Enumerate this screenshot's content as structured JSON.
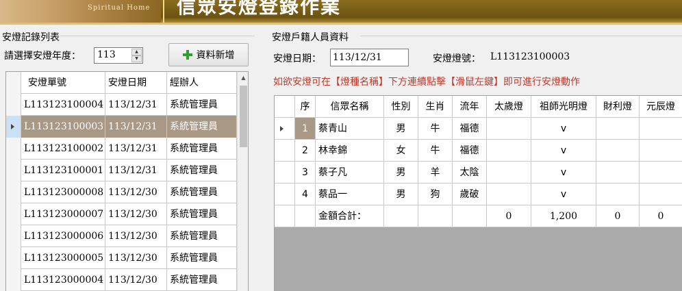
{
  "banner": {
    "subtitle": "Spiritual Home",
    "title": "信眾安燈登錄作業"
  },
  "left_panel": {
    "group_title": "安燈記錄列表",
    "year_label": "請選擇安燈年度：",
    "year_value": "113",
    "add_button_label": "資料新增",
    "columns": [
      "安燈單號",
      "安燈日期",
      "經辦人"
    ],
    "rows": [
      {
        "no": "L113123100004",
        "date": "113/12/31",
        "handler": "系統管理員"
      },
      {
        "no": "L113123100003",
        "date": "113/12/31",
        "handler": "系統管理員"
      },
      {
        "no": "L113123100002",
        "date": "113/12/31",
        "handler": "系統管理員"
      },
      {
        "no": "L113123100001",
        "date": "113/12/31",
        "handler": "系統管理員"
      },
      {
        "no": "L113123000008",
        "date": "113/12/30",
        "handler": "系統管理員"
      },
      {
        "no": "L113123000007",
        "date": "113/12/30",
        "handler": "系統管理員"
      },
      {
        "no": "L113123000006",
        "date": "113/12/30",
        "handler": "系統管理員"
      },
      {
        "no": "L113123000005",
        "date": "113/12/30",
        "handler": "系統管理員"
      },
      {
        "no": "L113123000004",
        "date": "113/12/30",
        "handler": "系統管理員"
      }
    ]
  },
  "right_panel": {
    "group_title": "安燈戶籍人員資料",
    "date_label": "安燈日期：",
    "date_value": "113/12/31",
    "lamp_no_label": "安燈燈號：",
    "lamp_no_value": "L113123100003",
    "hint": "如欲安燈可在【燈種名稱】下方連續點擊【滑鼠左鍵】即可進行安燈動作",
    "columns": [
      "序",
      "信眾名稱",
      "性別",
      "生肖",
      "流年",
      "太歲燈",
      "祖師光明燈",
      "財利燈",
      "元辰燈"
    ],
    "rows": [
      {
        "seq": "1",
        "name": "蔡青山",
        "gender": "男",
        "zodiac": "牛",
        "year": "福德",
        "taisui": "",
        "guangming": "v",
        "caili": "",
        "yuanchen": ""
      },
      {
        "seq": "2",
        "name": "林幸錦",
        "gender": "女",
        "zodiac": "牛",
        "year": "福德",
        "taisui": "",
        "guangming": "v",
        "caili": "",
        "yuanchen": ""
      },
      {
        "seq": "3",
        "name": "蔡子凡",
        "gender": "男",
        "zodiac": "羊",
        "year": "太陰",
        "taisui": "",
        "guangming": "v",
        "caili": "",
        "yuanchen": ""
      },
      {
        "seq": "4",
        "name": "蔡品一",
        "gender": "男",
        "zodiac": "狗",
        "year": "歲破",
        "taisui": "",
        "guangming": "v",
        "caili": "",
        "yuanchen": ""
      }
    ],
    "total": {
      "label": "金額合計：",
      "taisui": "0",
      "guangming": "1,200",
      "caili": "0",
      "yuanchen": "0"
    }
  },
  "colors": {
    "selected_row": "#a89885",
    "hint_text": "#c0392b",
    "grid_empty": "#aaaaaa"
  }
}
